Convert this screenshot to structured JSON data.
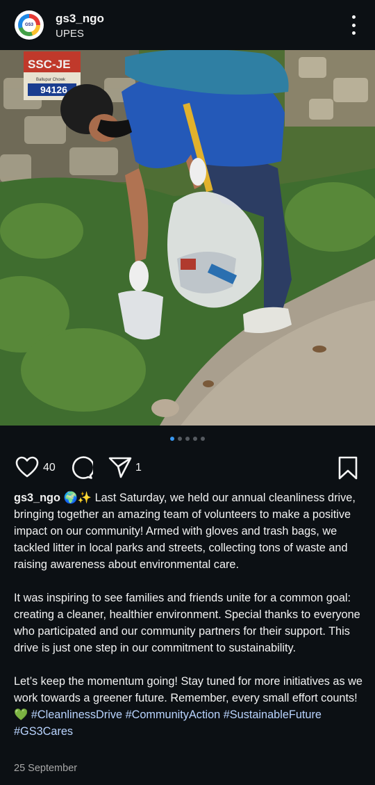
{
  "header": {
    "username": "gs3_ngo",
    "subtitle": "UPES",
    "avatar_text": "GS3"
  },
  "photo": {
    "sign_text": "SSC-JE",
    "sign_sub": "Ballupur Chowk",
    "sign_phone": "94126",
    "carousel_total": 5,
    "carousel_active": 1
  },
  "actions": {
    "likes": "40",
    "shares": "1"
  },
  "caption": {
    "username": "gs3_ngo",
    "emoji": "🌍✨",
    "p1": "Last Saturday, we held our annual cleanliness drive, bringing together an amazing team of volunteers to make a positive impact on our community! Armed with gloves and trash bags, we tackled litter in local parks and streets, collecting tons of waste and raising awareness about environmental care.",
    "p2": "It was inspiring to see families and friends unite for a common goal: creating a cleaner, healthier environment. Special thanks to everyone who participated and our community partners for their support. This drive is just one step in our commitment to sustainability.",
    "p3": "Let’s keep the momentum going! Stay tuned for more initiatives as we work towards a greener future. Remember, every small effort counts!",
    "heart_emoji": "💚",
    "hashtags": [
      "#CleanlinessDrive",
      "#CommunityAction",
      "#SustainableFuture",
      "#GS3Cares"
    ]
  },
  "date": "25 September",
  "colors": {
    "background": "#0c1014",
    "accent_blue": "#3897f0",
    "hashtag": "#b9d4ff"
  }
}
